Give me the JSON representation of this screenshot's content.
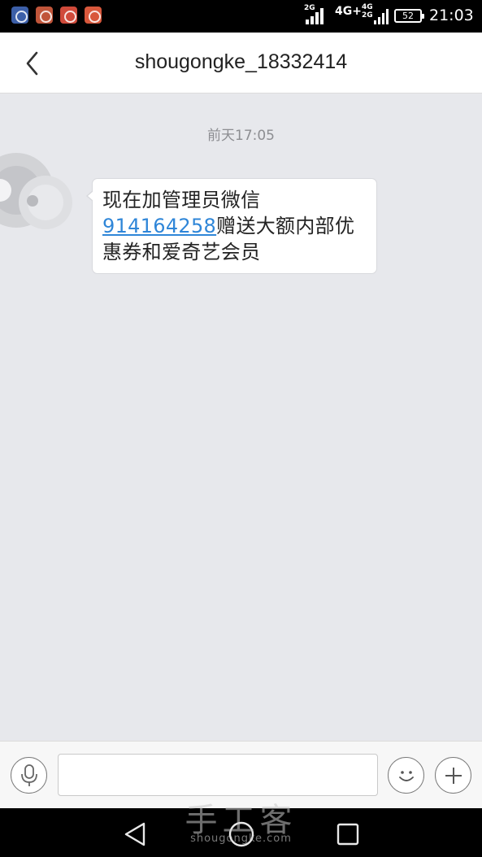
{
  "status_bar": {
    "notification_icons": [
      "app-icon-blue",
      "app-icon-orange",
      "app-icon-red",
      "app-icon-shield"
    ],
    "sim1_network": "2G",
    "sim2_network": "4G+",
    "sim2_sub_top": "4G",
    "sim2_sub_bottom": "2G",
    "battery": "52",
    "time": "21:03"
  },
  "header": {
    "back_icon": "chevron-left-icon",
    "title": "shougongke_18332414"
  },
  "conversation": {
    "timestamp": "前天17:05",
    "message": {
      "text_before": "现在加管理员微信",
      "link": "914164258",
      "text_after": "赠送大额内部优惠券和爱奇艺会员"
    }
  },
  "input_bar": {
    "voice_icon": "microphone-icon",
    "text_value": "",
    "emoji_icon": "smiley-icon",
    "add_icon": "plus-icon"
  },
  "nav_bar": {
    "back_icon": "triangle-back-icon",
    "home_icon": "circle-home-icon",
    "recents_icon": "square-recents-icon"
  },
  "watermark": {
    "main": "手工客",
    "sub": "shougongke.com"
  },
  "colors": {
    "chat_background": "#e7e8ec",
    "link": "#2f86d8",
    "header_background": "#ffffff"
  }
}
